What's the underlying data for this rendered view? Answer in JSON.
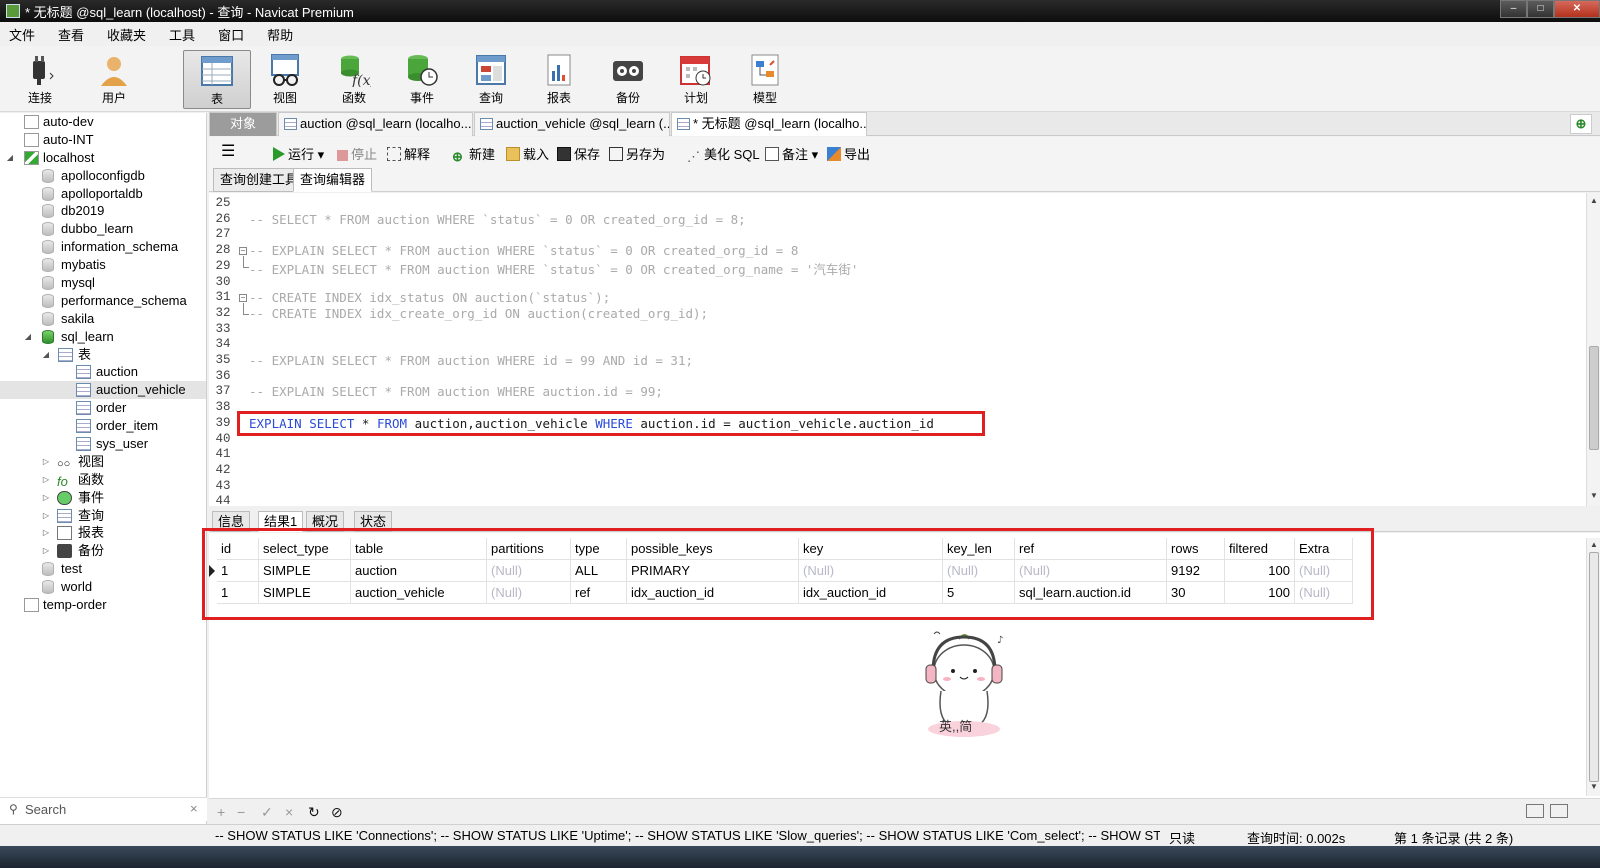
{
  "window": {
    "title": "* 无标题 @sql_learn (localhost) - 查询 - Navicat Premium",
    "buttons": [
      "–",
      "□",
      "✕"
    ]
  },
  "menu": [
    "文件",
    "查看",
    "收藏夹",
    "工具",
    "窗口",
    "帮助"
  ],
  "toolbar": [
    {
      "label": "连接",
      "icon": "plug-icon"
    },
    {
      "label": "用户",
      "icon": "user-icon"
    },
    {
      "label": "表",
      "icon": "table-icon",
      "active": true
    },
    {
      "label": "视图",
      "icon": "view-icon"
    },
    {
      "label": "函数",
      "icon": "function-icon"
    },
    {
      "label": "事件",
      "icon": "event-icon"
    },
    {
      "label": "查询",
      "icon": "query-icon"
    },
    {
      "label": "报表",
      "icon": "report-icon"
    },
    {
      "label": "备份",
      "icon": "backup-icon"
    },
    {
      "label": "计划",
      "icon": "schedule-icon"
    },
    {
      "label": "模型",
      "icon": "model-icon"
    }
  ],
  "nav": {
    "tree": [
      {
        "label": "auto-dev",
        "type": "connection"
      },
      {
        "label": "auto-INT",
        "type": "connection"
      },
      {
        "label": "localhost",
        "type": "connection-open",
        "expanded": true
      },
      {
        "label": "apolloconfigdb",
        "type": "db"
      },
      {
        "label": "apolloportaldb",
        "type": "db"
      },
      {
        "label": "db2019",
        "type": "db"
      },
      {
        "label": "dubbo_learn",
        "type": "db"
      },
      {
        "label": "information_schema",
        "type": "db"
      },
      {
        "label": "mybatis",
        "type": "db"
      },
      {
        "label": "mysql",
        "type": "db"
      },
      {
        "label": "performance_schema",
        "type": "db"
      },
      {
        "label": "sakila",
        "type": "db"
      },
      {
        "label": "sql_learn",
        "type": "db-open",
        "expanded": true
      },
      {
        "label": "表",
        "type": "tables-folder",
        "expanded": true
      },
      {
        "label": "auction",
        "type": "table"
      },
      {
        "label": "auction_vehicle",
        "type": "table",
        "selected": true
      },
      {
        "label": "order",
        "type": "table"
      },
      {
        "label": "order_item",
        "type": "table"
      },
      {
        "label": "sys_user",
        "type": "table"
      },
      {
        "label": "视图",
        "type": "views-folder"
      },
      {
        "label": "函数",
        "type": "functions-folder"
      },
      {
        "label": "事件",
        "type": "events-folder"
      },
      {
        "label": "查询",
        "type": "queries-folder"
      },
      {
        "label": "报表",
        "type": "reports-folder"
      },
      {
        "label": "备份",
        "type": "backups-folder"
      },
      {
        "label": "test",
        "type": "db"
      },
      {
        "label": "world",
        "type": "db"
      },
      {
        "label": "temp-order",
        "type": "connection"
      }
    ],
    "search_label": "Search"
  },
  "doc_tabs": [
    {
      "label": "对象"
    },
    {
      "label": "auction @sql_learn (localho..."
    },
    {
      "label": "auction_vehicle @sql_learn (..."
    },
    {
      "label": "* 无标题 @sql_learn (localho...",
      "active": true
    }
  ],
  "query_toolbar": {
    "run": "运行",
    "stop": "停止",
    "explain": "解释",
    "new": "新建",
    "load": "载入",
    "save": "保存",
    "save_as": "另存为",
    "beautify": "美化 SQL",
    "note": "备注",
    "export": "导出"
  },
  "sub_tabs": [
    "查询创建工具",
    "查询编辑器"
  ],
  "editor": {
    "lines": [
      {
        "n": "25",
        "text": ""
      },
      {
        "n": "26",
        "text": "-- SELECT * FROM auction WHERE `status` = 0 OR created_org_id = 8;"
      },
      {
        "n": "27",
        "text": ""
      },
      {
        "n": "28",
        "text": "-- EXPLAIN SELECT * FROM auction WHERE `status` = 0 OR created_org_id = 8"
      },
      {
        "n": "29",
        "text": "-- EXPLAIN SELECT * FROM auction WHERE `status` = 0 OR created_org_name = '汽车街'"
      },
      {
        "n": "30",
        "text": ""
      },
      {
        "n": "31",
        "text": "-- CREATE INDEX idx_status ON auction(`status`);"
      },
      {
        "n": "32",
        "text": "-- CREATE INDEX idx_create_org_id ON auction(created_org_id);"
      },
      {
        "n": "33",
        "text": ""
      },
      {
        "n": "34",
        "text": ""
      },
      {
        "n": "35",
        "text": "-- EXPLAIN SELECT * FROM auction WHERE id = 99 AND id = 31;"
      },
      {
        "n": "36",
        "text": ""
      },
      {
        "n": "37",
        "text": "-- EXPLAIN SELECT * FROM auction WHERE auction.id = 99;"
      },
      {
        "n": "38",
        "text": ""
      },
      {
        "n": "39",
        "text": ""
      },
      {
        "n": "40",
        "text": ""
      },
      {
        "n": "41",
        "text": ""
      },
      {
        "n": "42",
        "text": ""
      },
      {
        "n": "43",
        "text": ""
      },
      {
        "n": "44",
        "text": ""
      }
    ],
    "active_sql": {
      "kw1": "EXPLAIN",
      "kw2": "SELECT",
      "star": "*",
      "kw3": "FROM",
      "tables": "auction,auction_vehicle",
      "kw4": "WHERE",
      "cond": "auction.id = auction_vehicle.auction_id"
    }
  },
  "result_tabs": [
    "信息",
    "结果1",
    "概况",
    "状态"
  ],
  "results": {
    "columns": [
      "id",
      "select_type",
      "table",
      "partitions",
      "type",
      "possible_keys",
      "key",
      "key_len",
      "ref",
      "rows",
      "filtered",
      "Extra"
    ],
    "rows": [
      [
        "1",
        "SIMPLE",
        "auction",
        "(Null)",
        "ALL",
        "PRIMARY",
        "(Null)",
        "(Null)",
        "(Null)",
        "9192",
        "100",
        "(Null)"
      ],
      [
        "1",
        "SIMPLE",
        "auction_vehicle",
        "(Null)",
        "ref",
        "idx_auction_id",
        "idx_auction_id",
        "5",
        "sql_learn.auction.id",
        "30",
        "100",
        "(Null)"
      ]
    ]
  },
  "sticker": {
    "text": "英,,简"
  },
  "status": {
    "sql": "-- SHOW STATUS LIKE 'Connections'; -- SHOW STATUS LIKE 'Uptime'; -- SHOW STATUS LIKE 'Slow_queries'; -- SHOW STATUS LIKE 'Com_select'; -- SHOW STATUS LIKE",
    "mode": "只读",
    "time": "查询时间: 0.002s",
    "records": "第 1 条记录 (共 2 条)"
  },
  "colors": {
    "highlight_box": "#e02020",
    "sql_keyword": "#2a4bd7",
    "comment": "#aaaaaa",
    "null_text": "#b8b8c8"
  }
}
